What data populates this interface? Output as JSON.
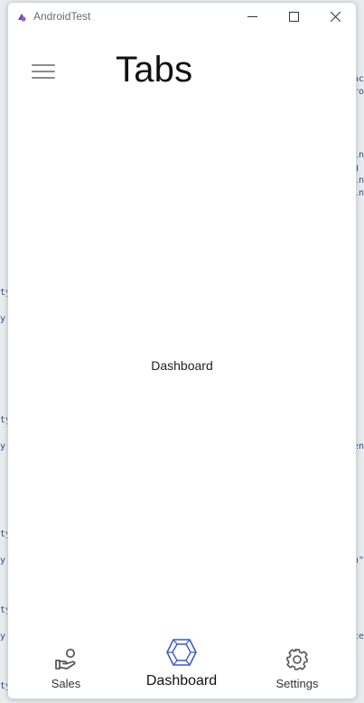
{
  "window": {
    "title": "AndroidTest",
    "controls": {
      "minimize": "minimize",
      "maximize": "maximize",
      "close": "close"
    }
  },
  "header": {
    "menu_icon": "hamburger-icon",
    "title": "Tabs"
  },
  "content": {
    "label": "Dashboard"
  },
  "tabs": [
    {
      "label": "Sales",
      "icon": "sales-hand-icon",
      "active": false
    },
    {
      "label": "Dashboard",
      "icon": "dashboard-cube-icon",
      "active": true
    },
    {
      "label": "Settings",
      "icon": "gear-icon",
      "active": false
    }
  ],
  "colors": {
    "accent": "#3b5bcc",
    "icon_gray": "#555555",
    "title_text": "#111111"
  }
}
